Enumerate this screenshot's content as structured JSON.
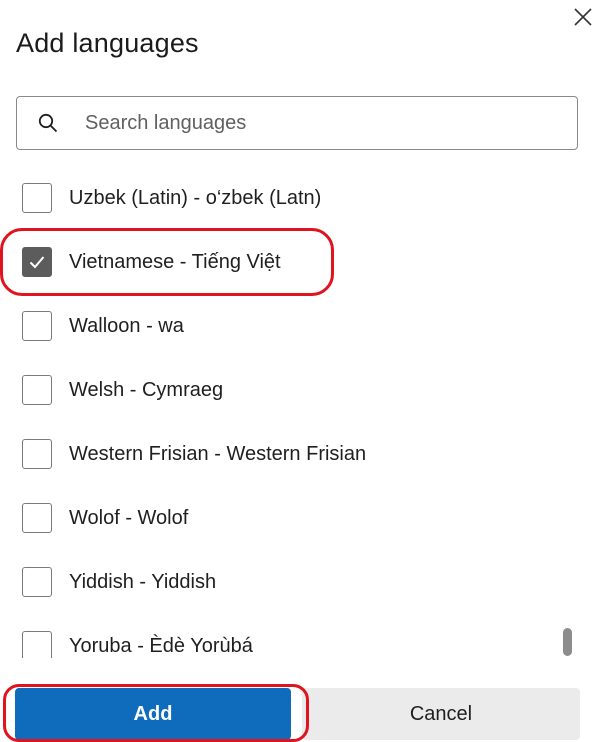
{
  "dialog": {
    "title": "Add languages",
    "close_icon": "close-icon"
  },
  "search": {
    "icon": "search-icon",
    "placeholder": "Search languages",
    "value": ""
  },
  "languages": [
    {
      "label": "Uzbek (Latin) - o‘zbek (Latn)",
      "checked": false
    },
    {
      "label": "Vietnamese - Tiếng Việt",
      "checked": true
    },
    {
      "label": "Walloon - wa",
      "checked": false
    },
    {
      "label": "Welsh - Cymraeg",
      "checked": false
    },
    {
      "label": "Western Frisian - Western Frisian",
      "checked": false
    },
    {
      "label": "Wolof - Wolof",
      "checked": false
    },
    {
      "label": "Yiddish - Yiddish",
      "checked": false
    },
    {
      "label": "Yoruba - Èdè Yorùbá",
      "checked": false
    }
  ],
  "footer": {
    "add_label": "Add",
    "cancel_label": "Cancel"
  },
  "colors": {
    "primary": "#0f6cbd",
    "highlight": "#e0141e",
    "checked": "#5c5c5c"
  }
}
